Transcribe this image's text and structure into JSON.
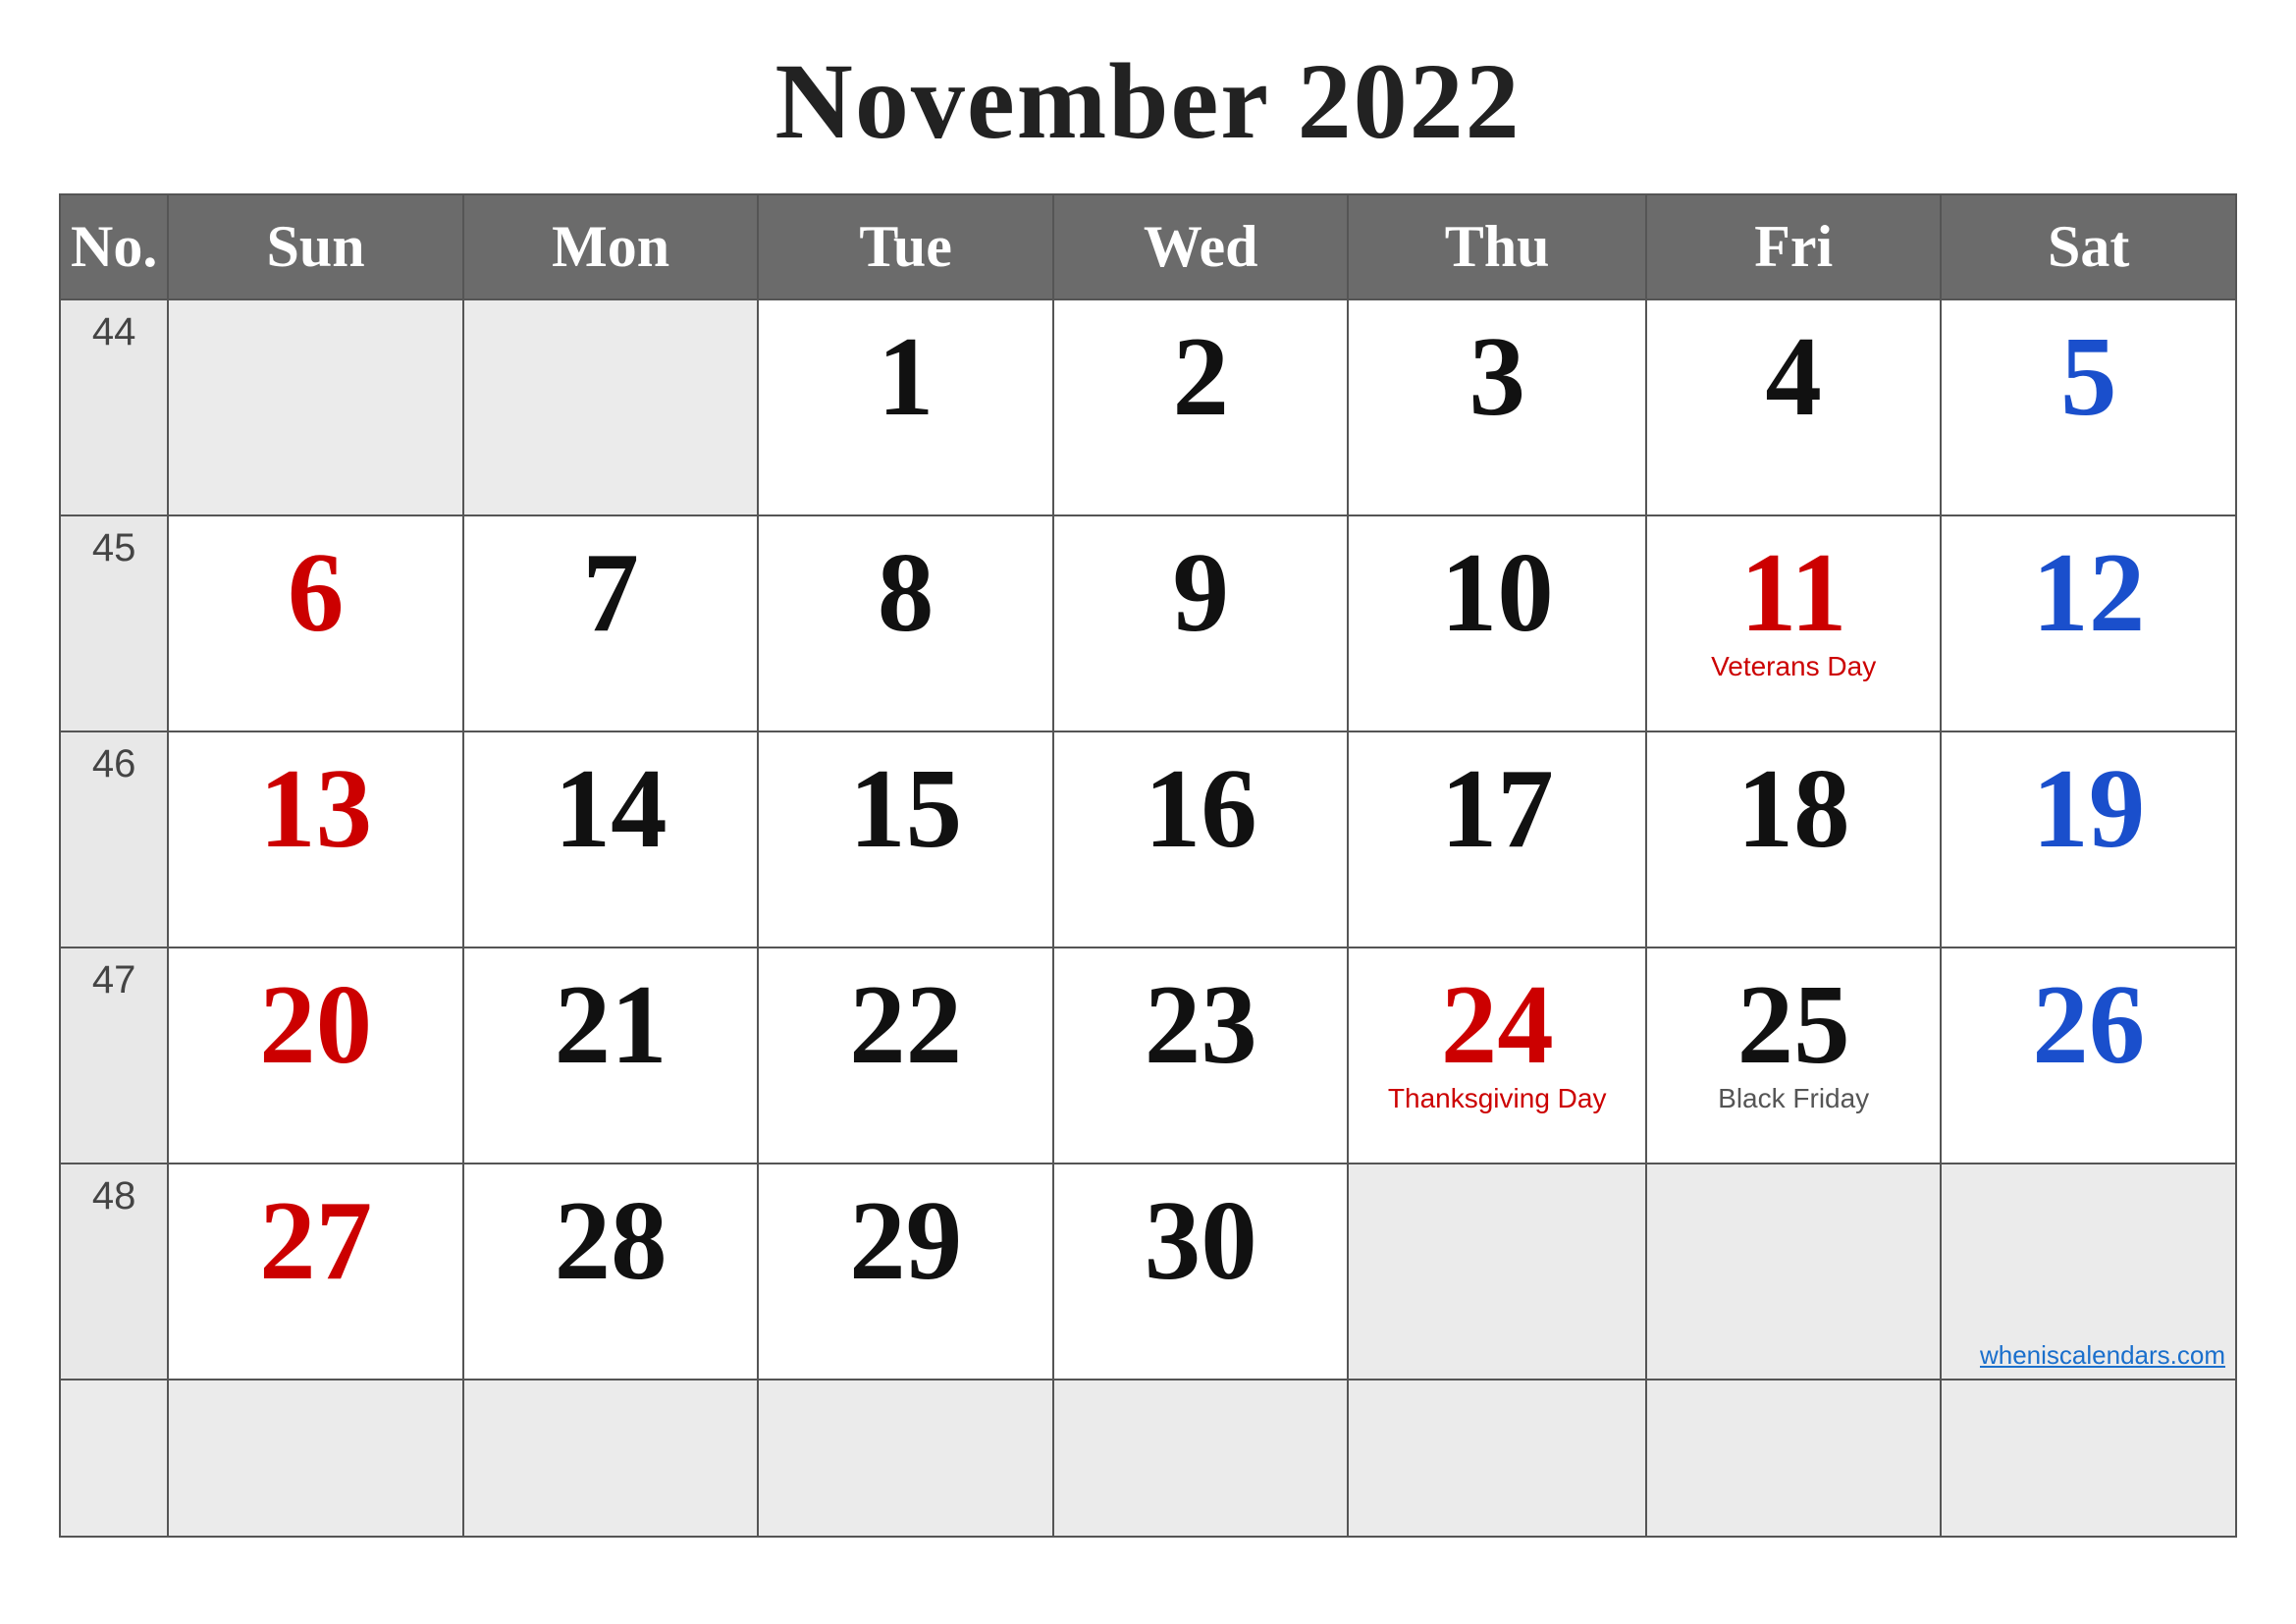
{
  "title": "November 2022",
  "headers": {
    "no": "No.",
    "sun": "Sun",
    "mon": "Mon",
    "tue": "Tue",
    "wed": "Wed",
    "thu": "Thu",
    "fri": "Fri",
    "sat": "Sat"
  },
  "weeks": [
    {
      "weekNo": "44",
      "days": [
        {
          "num": "",
          "color": "empty",
          "holiday": ""
        },
        {
          "num": "",
          "color": "empty",
          "holiday": ""
        },
        {
          "num": "1",
          "color": "black",
          "holiday": ""
        },
        {
          "num": "2",
          "color": "black",
          "holiday": ""
        },
        {
          "num": "3",
          "color": "black",
          "holiday": ""
        },
        {
          "num": "4",
          "color": "black",
          "holiday": ""
        },
        {
          "num": "5",
          "color": "blue",
          "holiday": ""
        }
      ]
    },
    {
      "weekNo": "45",
      "days": [
        {
          "num": "6",
          "color": "red",
          "holiday": ""
        },
        {
          "num": "7",
          "color": "black",
          "holiday": ""
        },
        {
          "num": "8",
          "color": "black",
          "holiday": ""
        },
        {
          "num": "9",
          "color": "black",
          "holiday": ""
        },
        {
          "num": "10",
          "color": "black",
          "holiday": ""
        },
        {
          "num": "11",
          "color": "red",
          "holiday": "Veterans Day"
        },
        {
          "num": "12",
          "color": "blue",
          "holiday": ""
        }
      ]
    },
    {
      "weekNo": "46",
      "days": [
        {
          "num": "13",
          "color": "red",
          "holiday": ""
        },
        {
          "num": "14",
          "color": "black",
          "holiday": ""
        },
        {
          "num": "15",
          "color": "black",
          "holiday": ""
        },
        {
          "num": "16",
          "color": "black",
          "holiday": ""
        },
        {
          "num": "17",
          "color": "black",
          "holiday": ""
        },
        {
          "num": "18",
          "color": "black",
          "holiday": ""
        },
        {
          "num": "19",
          "color": "blue",
          "holiday": ""
        }
      ]
    },
    {
      "weekNo": "47",
      "days": [
        {
          "num": "20",
          "color": "red",
          "holiday": ""
        },
        {
          "num": "21",
          "color": "black",
          "holiday": ""
        },
        {
          "num": "22",
          "color": "black",
          "holiday": ""
        },
        {
          "num": "23",
          "color": "black",
          "holiday": ""
        },
        {
          "num": "24",
          "color": "red",
          "holiday": "Thanksgiving Day"
        },
        {
          "num": "25",
          "color": "black",
          "holiday": "Black Friday"
        },
        {
          "num": "26",
          "color": "blue",
          "holiday": ""
        }
      ]
    },
    {
      "weekNo": "48",
      "days": [
        {
          "num": "27",
          "color": "red",
          "holiday": ""
        },
        {
          "num": "28",
          "color": "black",
          "holiday": ""
        },
        {
          "num": "29",
          "color": "black",
          "holiday": ""
        },
        {
          "num": "30",
          "color": "black",
          "holiday": ""
        },
        {
          "num": "",
          "color": "empty",
          "holiday": ""
        },
        {
          "num": "",
          "color": "empty",
          "holiday": ""
        },
        {
          "num": "",
          "color": "empty",
          "holiday": ""
        }
      ]
    }
  ],
  "watermark": "wheniscalendars.com"
}
